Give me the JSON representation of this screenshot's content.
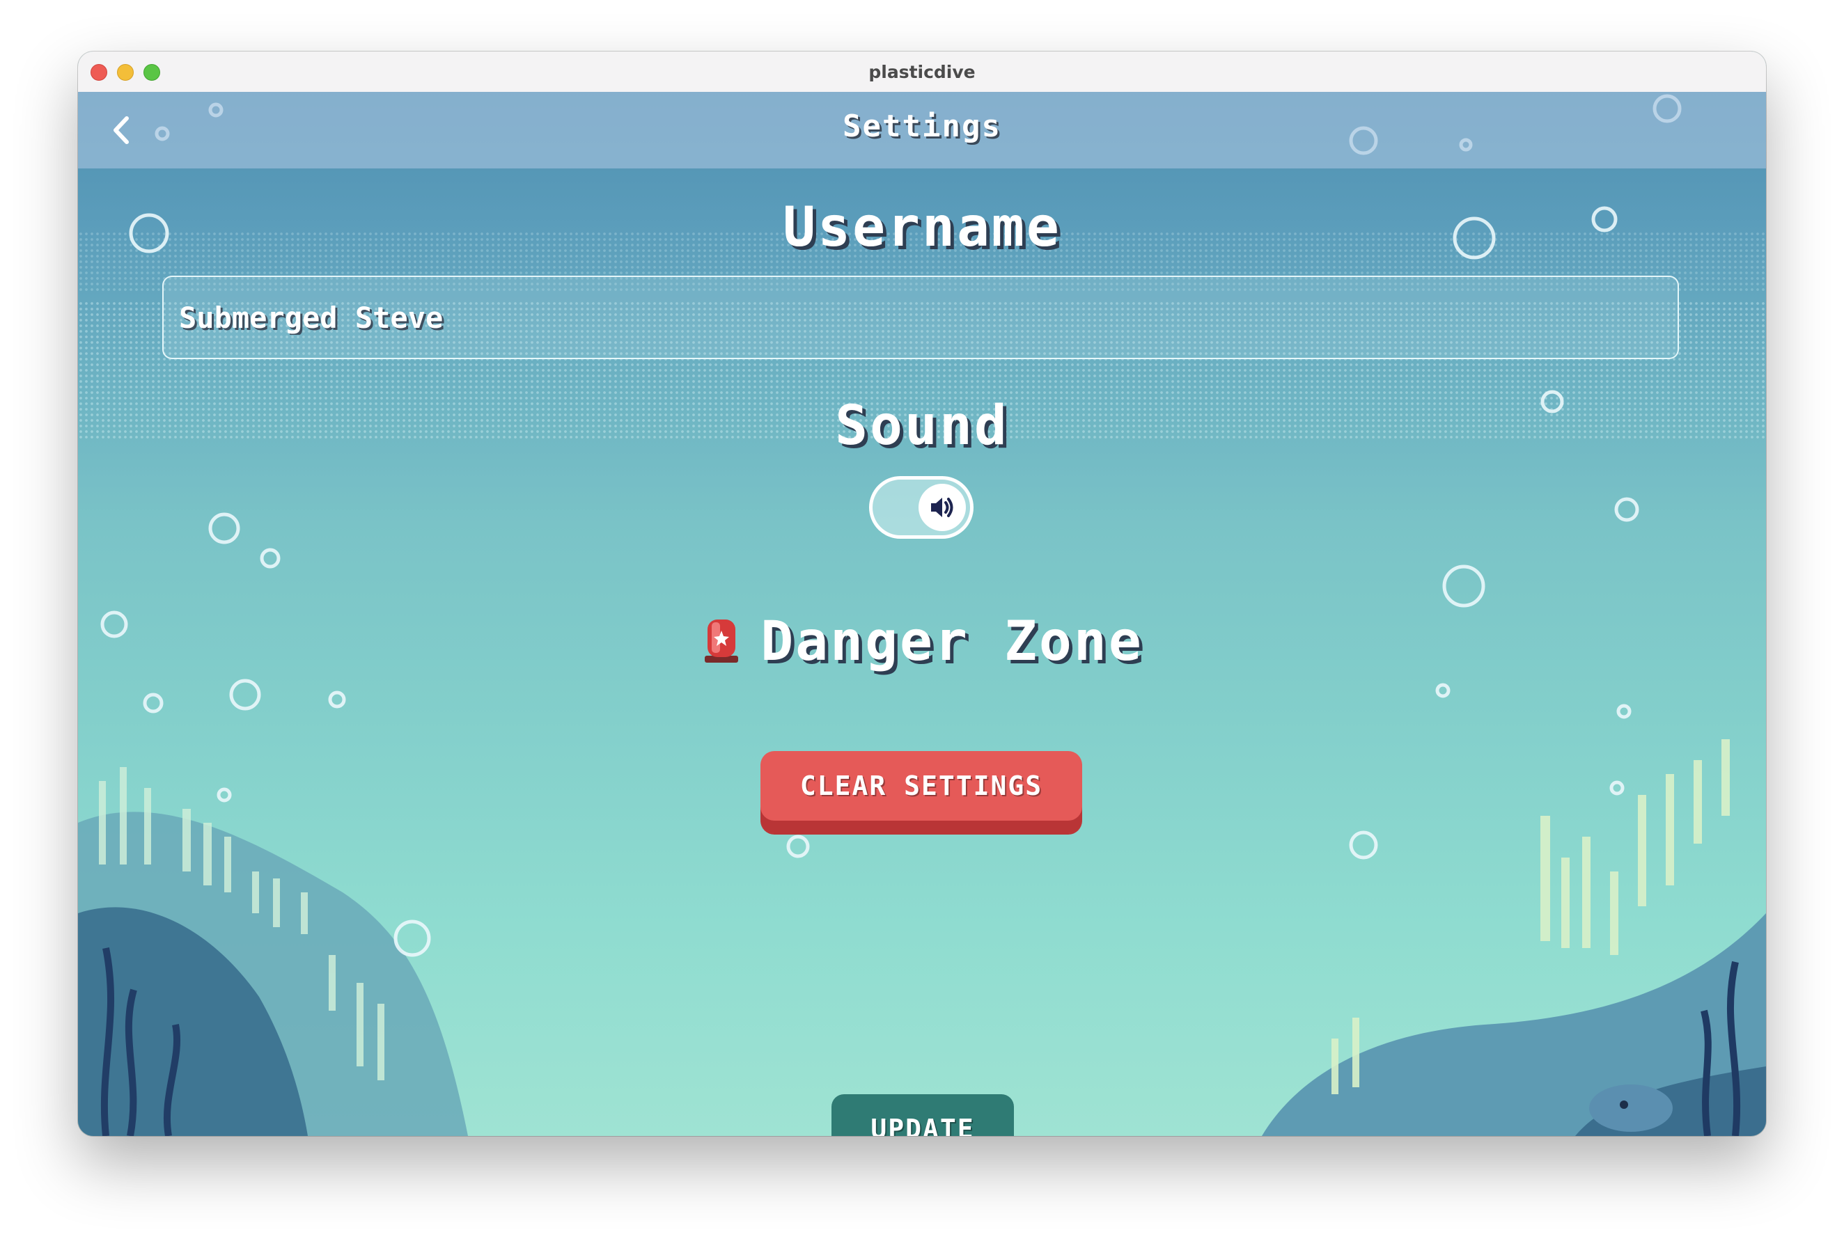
{
  "window": {
    "title": "plasticdive"
  },
  "header": {
    "title": "Settings",
    "back_icon": "chevron-left-icon"
  },
  "username": {
    "heading": "Username",
    "value": "Submerged Steve"
  },
  "sound": {
    "heading": "Sound",
    "enabled": true,
    "icon": "speaker-icon"
  },
  "danger_zone": {
    "icon": "alarm-light-icon",
    "heading": "Danger Zone",
    "clear_label": "CLEAR SETTINGS"
  },
  "actions": {
    "update_label": "UPDATE"
  },
  "colors": {
    "accent_danger": "#e55a58",
    "accent_update": "#2f7b74",
    "water_top": "#4f8fb0",
    "water_bottom": "#9fe3d3"
  }
}
